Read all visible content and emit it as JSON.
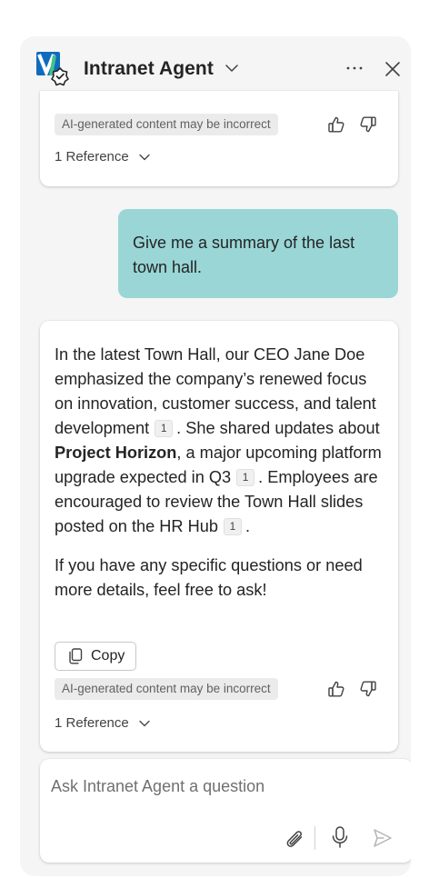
{
  "header": {
    "title": "Intranet Agent"
  },
  "previous_response": {
    "disclaimer": "AI-generated content may be incorrect",
    "references": "1 Reference"
  },
  "user_message": {
    "text": "Give me a summary of the last town hall."
  },
  "agent_response": {
    "p1_part1": "In the latest Town Hall, our CEO Jane Doe emphasized the company’s renewed focus on innovation, customer success, and talent development",
    "cite1": "1",
    "p1_part2": ". She shared updates about ",
    "p1_bold": "Project Horizon",
    "p1_part3": ", a major upcoming platform upgrade expected in Q3",
    "cite2": "1",
    "p1_part4": ". Employees are encouraged to review the Town Hall slides posted on the HR Hub",
    "cite3": "1",
    "p1_part5": ".",
    "p2": "If you have any specific questions or need more details, feel free to ask!",
    "copy_label": "Copy",
    "disclaimer": "AI-generated content may be incorrect",
    "references": "1 Reference"
  },
  "composer": {
    "placeholder": "Ask Intranet Agent a question"
  },
  "colors": {
    "user_bubble": "#9ad6d6",
    "panel_bg": "#f5f5f5",
    "card_bg": "#ffffff",
    "disclaimer_bg": "#ebebeb"
  },
  "icons": {
    "logo": "agent-logo-icon",
    "title_chevron": "chevron-down-icon",
    "more": "more-horizontal-icon",
    "close": "close-icon",
    "like": "thumbs-up-icon",
    "dislike": "thumbs-down-icon",
    "copy": "copy-icon",
    "attach": "paperclip-icon",
    "mic": "microphone-icon",
    "send": "send-icon"
  }
}
